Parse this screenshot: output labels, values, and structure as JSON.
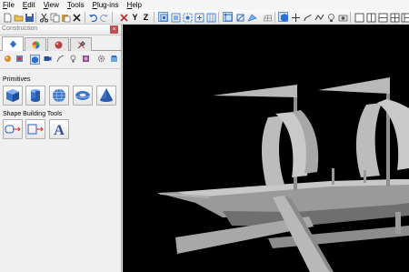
{
  "menu": [
    {
      "label": "File",
      "key": "file"
    },
    {
      "label": "Edit",
      "key": "edit"
    },
    {
      "label": "View",
      "key": "view"
    },
    {
      "label": "Tools",
      "key": "tools"
    },
    {
      "label": "Plug-ins",
      "key": "plugins"
    },
    {
      "label": "Help",
      "key": "help"
    }
  ],
  "toolbar": {
    "axis_x": "X",
    "axis_y": "Y",
    "axis_z": "Z"
  },
  "panel": {
    "title": "Construction",
    "close_glyph": "×",
    "primitives_label": "Primitives",
    "shape_tools_label": "Shape Building Tools",
    "text_tool_glyph": "A"
  },
  "colors": {
    "accent": "#2b6fd0",
    "viewport_bg": "#000000",
    "model": "#bdbdbd"
  },
  "icons": {
    "primitives": [
      "cube-icon",
      "cylinder-icon",
      "sphere-icon",
      "torus-icon",
      "cone-icon"
    ],
    "shape_tools": [
      "extrude-icon",
      "lathe-icon",
      "text-icon"
    ]
  }
}
